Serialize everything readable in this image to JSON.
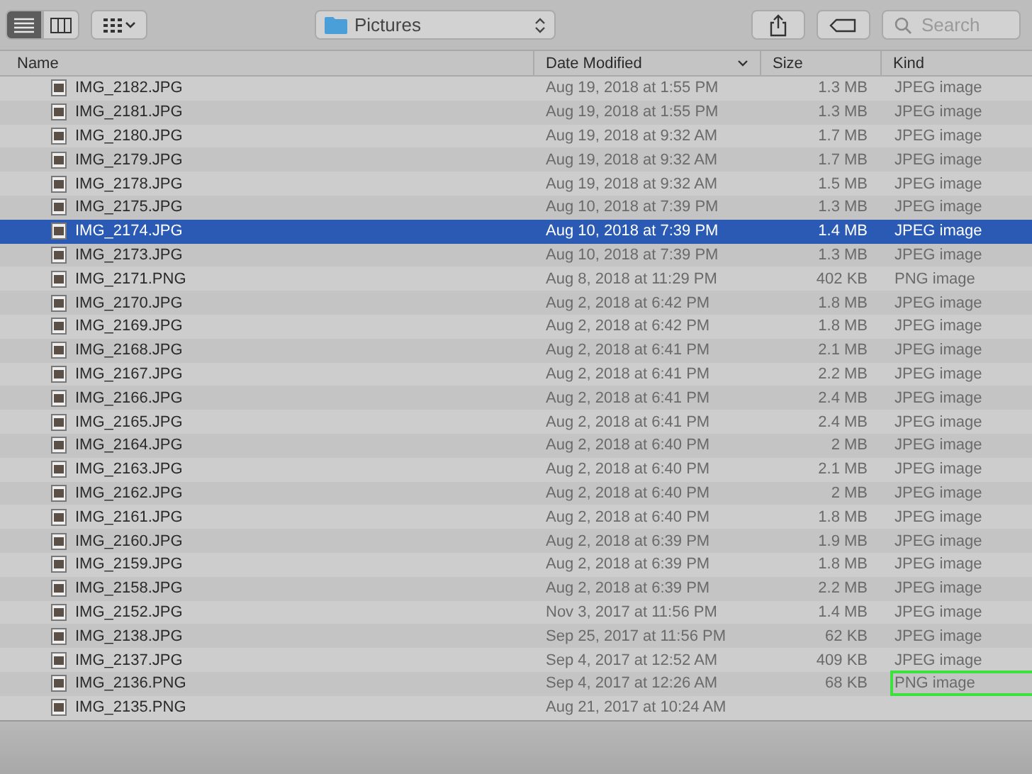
{
  "toolbar": {
    "views": [
      {
        "kind": "list",
        "selected": true
      },
      {
        "kind": "columns",
        "selected": false
      },
      {
        "kind": "gallery",
        "selected": false
      }
    ],
    "location": "Pictures",
    "search": {
      "placeholder": "Search"
    }
  },
  "table": {
    "columns": [
      {
        "label": "Name",
        "sorted": false
      },
      {
        "label": "Date Modified",
        "sorted": true
      },
      {
        "label": "Size",
        "sorted": false
      },
      {
        "label": "Kind",
        "sorted": false
      }
    ],
    "rows": [
      {
        "name": "IMG_2182.JPG",
        "date": "Aug 19, 2018 at 1:55 PM",
        "size": "1.3 MB",
        "kind": "JPEG image",
        "selected": false
      },
      {
        "name": "IMG_2181.JPG",
        "date": "Aug 19, 2018 at 1:55 PM",
        "size": "1.3 MB",
        "kind": "JPEG image",
        "selected": false
      },
      {
        "name": "IMG_2180.JPG",
        "date": "Aug 19, 2018 at 9:32 AM",
        "size": "1.7 MB",
        "kind": "JPEG image",
        "selected": false
      },
      {
        "name": "IMG_2179.JPG",
        "date": "Aug 19, 2018 at 9:32 AM",
        "size": "1.7 MB",
        "kind": "JPEG image",
        "selected": false
      },
      {
        "name": "IMG_2178.JPG",
        "date": "Aug 19, 2018 at 9:32 AM",
        "size": "1.5 MB",
        "kind": "JPEG image",
        "selected": false
      },
      {
        "name": "IMG_2175.JPG",
        "date": "Aug 10, 2018 at 7:39 PM",
        "size": "1.3 MB",
        "kind": "JPEG image",
        "selected": false
      },
      {
        "name": "IMG_2174.JPG",
        "date": "Aug 10, 2018 at 7:39 PM",
        "size": "1.4 MB",
        "kind": "JPEG image",
        "selected": true
      },
      {
        "name": "IMG_2173.JPG",
        "date": "Aug 10, 2018 at 7:39 PM",
        "size": "1.3 MB",
        "kind": "JPEG image",
        "selected": false
      },
      {
        "name": "IMG_2171.PNG",
        "date": "Aug 8, 2018 at 11:29 PM",
        "size": "402 KB",
        "kind": "PNG image",
        "selected": false
      },
      {
        "name": "IMG_2170.JPG",
        "date": "Aug 2, 2018 at 6:42 PM",
        "size": "1.8 MB",
        "kind": "JPEG image",
        "selected": false
      },
      {
        "name": "IMG_2169.JPG",
        "date": "Aug 2, 2018 at 6:42 PM",
        "size": "1.8 MB",
        "kind": "JPEG image",
        "selected": false
      },
      {
        "name": "IMG_2168.JPG",
        "date": "Aug 2, 2018 at 6:41 PM",
        "size": "2.1 MB",
        "kind": "JPEG image",
        "selected": false
      },
      {
        "name": "IMG_2167.JPG",
        "date": "Aug 2, 2018 at 6:41 PM",
        "size": "2.2 MB",
        "kind": "JPEG image",
        "selected": false
      },
      {
        "name": "IMG_2166.JPG",
        "date": "Aug 2, 2018 at 6:41 PM",
        "size": "2.4 MB",
        "kind": "JPEG image",
        "selected": false
      },
      {
        "name": "IMG_2165.JPG",
        "date": "Aug 2, 2018 at 6:41 PM",
        "size": "2.4 MB",
        "kind": "JPEG image",
        "selected": false
      },
      {
        "name": "IMG_2164.JPG",
        "date": "Aug 2, 2018 at 6:40 PM",
        "size": "2 MB",
        "kind": "JPEG image",
        "selected": false
      },
      {
        "name": "IMG_2163.JPG",
        "date": "Aug 2, 2018 at 6:40 PM",
        "size": "2.1 MB",
        "kind": "JPEG image",
        "selected": false
      },
      {
        "name": "IMG_2162.JPG",
        "date": "Aug 2, 2018 at 6:40 PM",
        "size": "2 MB",
        "kind": "JPEG image",
        "selected": false
      },
      {
        "name": "IMG_2161.JPG",
        "date": "Aug 2, 2018 at 6:40 PM",
        "size": "1.8 MB",
        "kind": "JPEG image",
        "selected": false
      },
      {
        "name": "IMG_2160.JPG",
        "date": "Aug 2, 2018 at 6:39 PM",
        "size": "1.9 MB",
        "kind": "JPEG image",
        "selected": false
      },
      {
        "name": "IMG_2159.JPG",
        "date": "Aug 2, 2018 at 6:39 PM",
        "size": "1.8 MB",
        "kind": "JPEG image",
        "selected": false
      },
      {
        "name": "IMG_2158.JPG",
        "date": "Aug 2, 2018 at 6:39 PM",
        "size": "2.2 MB",
        "kind": "JPEG image",
        "selected": false
      },
      {
        "name": "IMG_2152.JPG",
        "date": "Nov 3, 2017 at 11:56 PM",
        "size": "1.4 MB",
        "kind": "JPEG image",
        "selected": false
      },
      {
        "name": "IMG_2138.JPG",
        "date": "Sep 25, 2017 at 11:56 PM",
        "size": "62 KB",
        "kind": "JPEG image",
        "selected": false
      },
      {
        "name": "IMG_2137.JPG",
        "date": "Sep 4, 2017 at 12:52 AM",
        "size": "409 KB",
        "kind": "JPEG image",
        "selected": false
      },
      {
        "name": "IMG_2136.PNG",
        "date": "Sep 4, 2017 at 12:26 AM",
        "size": "68 KB",
        "kind": "PNG image",
        "selected": false,
        "highlighted": true
      },
      {
        "name": "IMG_2135.PNG",
        "date": "Aug 21, 2017 at 10:24 AM",
        "selected": false
      }
    ]
  }
}
